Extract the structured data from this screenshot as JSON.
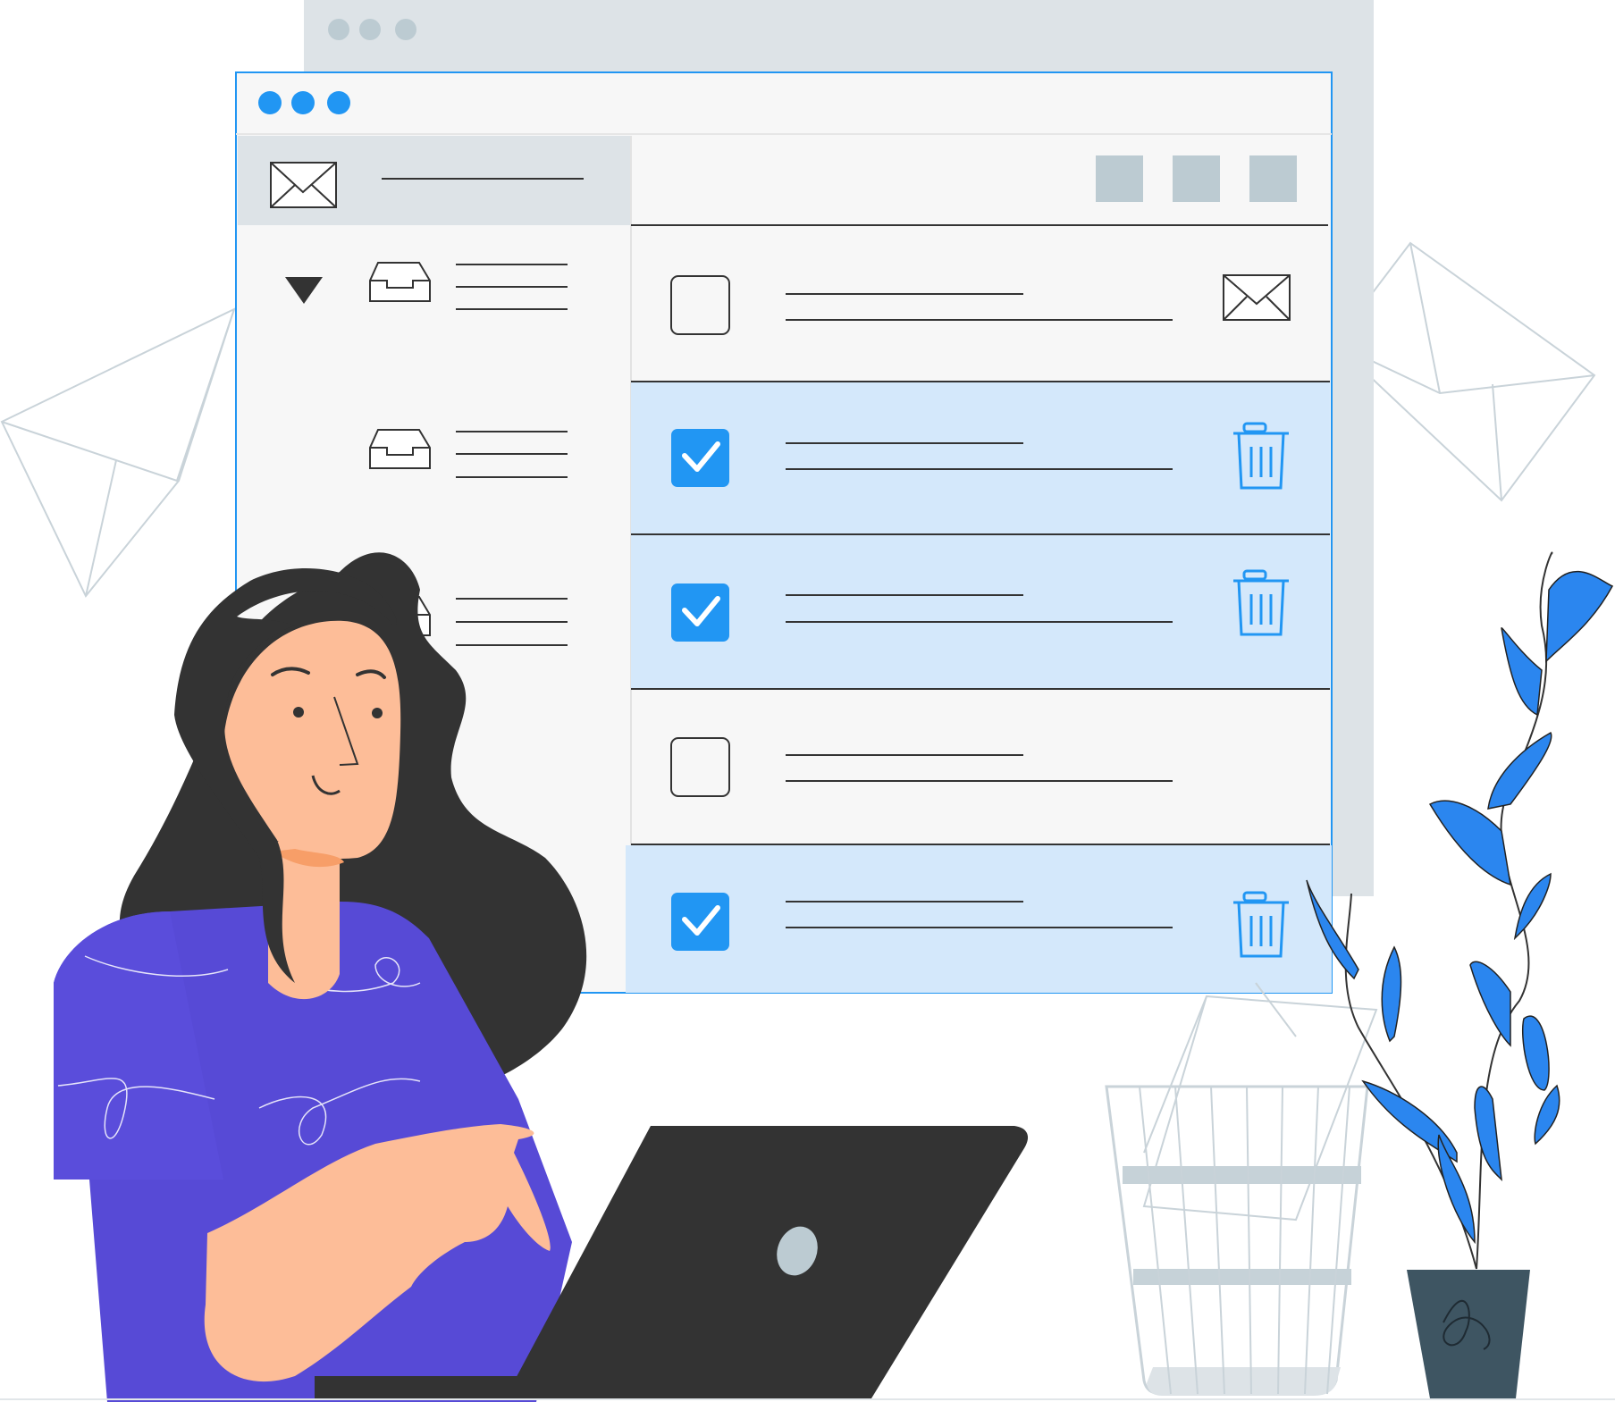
{
  "colors": {
    "accent": "#2196f3",
    "selected_row_bg": "#d4e8fb",
    "panel_bg": "#f7f7f7",
    "back_window": "#dde3e7",
    "button_gray": "#bccbd2",
    "outline": "#333333",
    "shirt": "#574ad6",
    "skin": "#fdbd98",
    "hair": "#333333",
    "laptop": "#333333",
    "pot": "#3e5562",
    "leaf": "#2b86ef"
  },
  "icons": {
    "window_dots": "traffic-dots",
    "sidebar_header": "envelope-icon",
    "folders": [
      "inbox-tray-icon",
      "inbox-tray-icon",
      "inbox-tray-icon"
    ],
    "collapse": "triangle-down-icon",
    "toolbar": [
      "square-button",
      "square-button",
      "square-button"
    ],
    "row_unread": "envelope-icon",
    "row_delete": "trash-icon"
  },
  "mail_rows": [
    {
      "checked": false,
      "action_icon": "envelope-icon"
    },
    {
      "checked": true,
      "action_icon": "trash-icon"
    },
    {
      "checked": true,
      "action_icon": "trash-icon"
    },
    {
      "checked": false,
      "action_icon": ""
    },
    {
      "checked": true,
      "action_icon": "trash-icon"
    }
  ]
}
